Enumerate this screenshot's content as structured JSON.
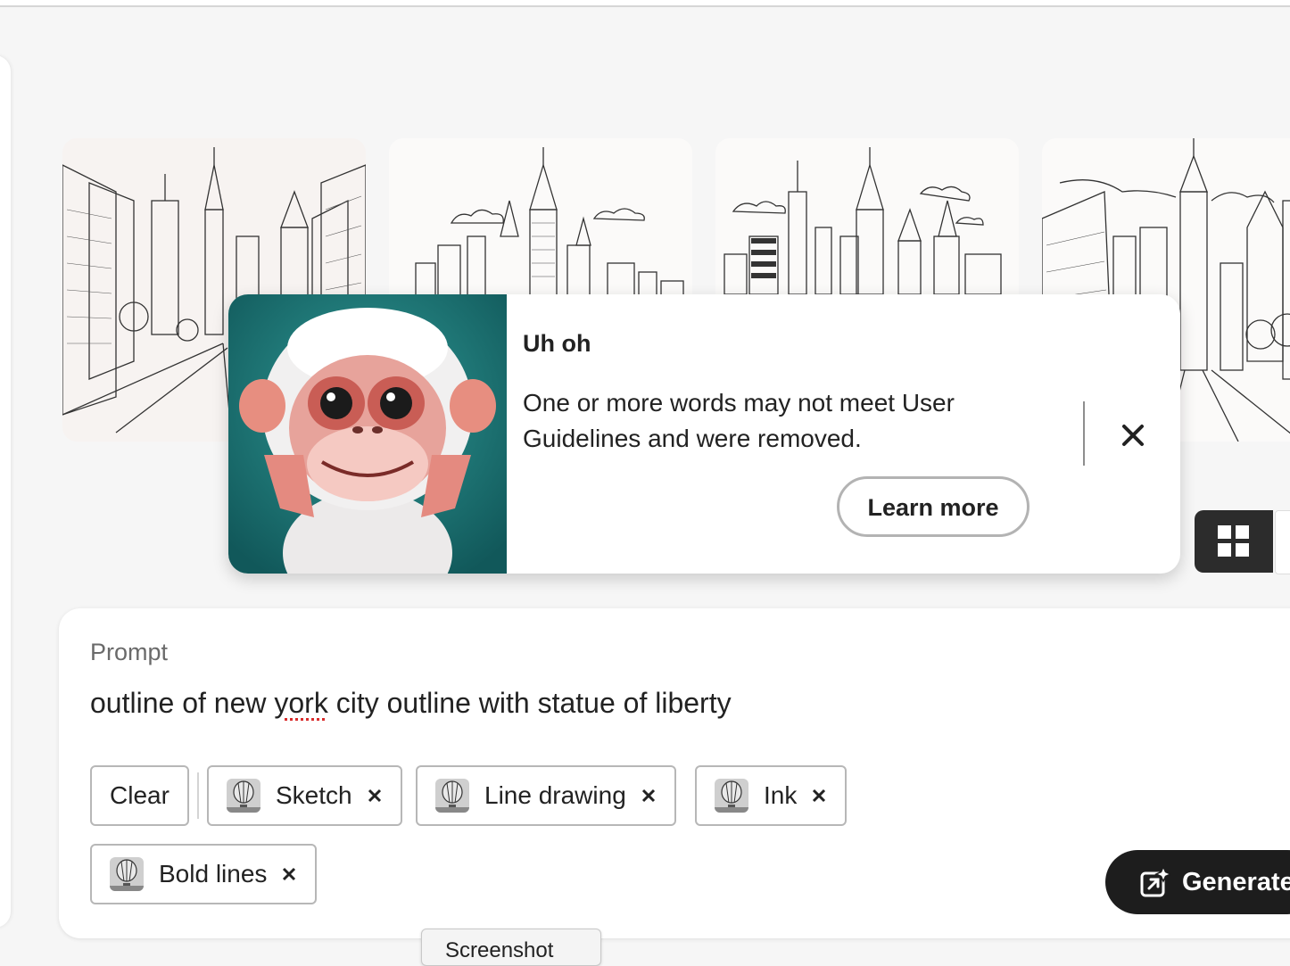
{
  "gallery": {
    "images": [
      {
        "name": "nyc-street-sketch"
      },
      {
        "name": "nyc-skyline-sketch"
      },
      {
        "name": "nyc-skyline-clouds-sketch"
      },
      {
        "name": "nyc-avenue-sketch"
      }
    ]
  },
  "toast": {
    "title": "Uh oh",
    "message": "One or more words may not meet User Guidelines and were removed.",
    "learn_more": "Learn more",
    "image": "monkey-illustration",
    "close_icon": "close-icon"
  },
  "view_toggle": {
    "grid_icon": "grid-icon"
  },
  "prompt": {
    "label": "Prompt",
    "text_before": "outline of new ",
    "text_flagged": "york",
    "text_after": " city outline with statue of liberty"
  },
  "chips": {
    "clear": "Clear",
    "styles": [
      {
        "label": "Sketch",
        "icon": "balloon-icon"
      },
      {
        "label": "Line drawing",
        "icon": "balloon-icon"
      },
      {
        "label": "Ink",
        "icon": "balloon-icon"
      },
      {
        "label": "Bold lines",
        "icon": "balloon-icon"
      }
    ],
    "remove_icon": "close-icon"
  },
  "generate": {
    "label": "Generate",
    "icon": "generate-sparkle-icon"
  },
  "tooltip": {
    "text": "Screenshot"
  },
  "colors": {
    "background": "#f6f6f6",
    "toast_bg": "#ffffff",
    "dark_button": "#1d1d1d",
    "monkey_bg": "#1e7a7a"
  }
}
